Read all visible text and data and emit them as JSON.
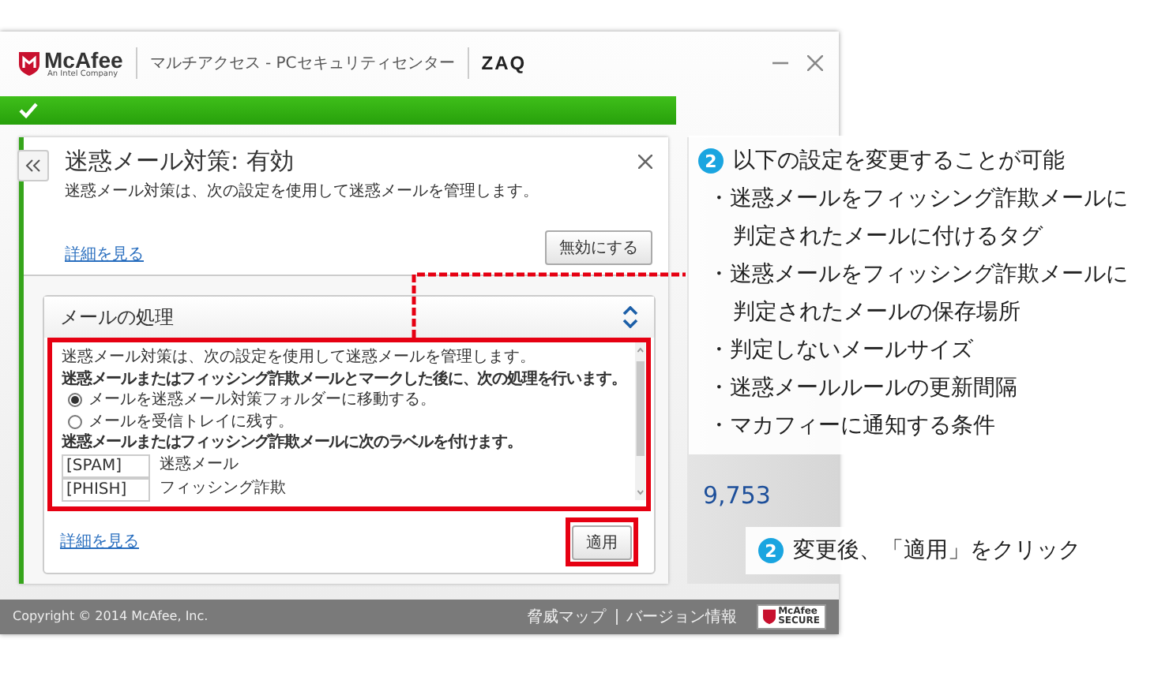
{
  "window": {
    "brand": "McAfee",
    "brand_sub": "An Intel Company",
    "title": "マルチアクセス - PCセキュリティセンター",
    "partner": "ZAQ"
  },
  "status": {
    "protected": true
  },
  "panel": {
    "title": "迷惑メール対策: 有効",
    "description": "迷惑メール対策は、次の設定を使用して迷惑メールを管理します。",
    "details_link": "詳細を見る",
    "disable_button": "無効にする"
  },
  "section": {
    "title": "メールの処理",
    "expanded": true,
    "intro": "迷惑メール対策は、次の設定を使用して迷惑メールを管理します。",
    "action_heading": "迷惑メールまたはフィッシング詐欺メールとマークした後に、次の処理を行います。",
    "options": [
      {
        "label": "メールを迷惑メール対策フォルダーに移動する。",
        "selected": true
      },
      {
        "label": "メールを受信トレイに残す。",
        "selected": false
      }
    ],
    "label_heading": "迷惑メールまたはフィッシング詐欺メールに次のラベルを付けます。",
    "labels": [
      {
        "value": "[SPAM]",
        "caption": "迷惑メール"
      },
      {
        "value": "[PHISH]",
        "caption": "フィッシング詐欺"
      }
    ],
    "details_link": "詳細を見る",
    "apply_button": "適用"
  },
  "sidebar": {
    "scan_count": "9,753"
  },
  "footer": {
    "copyright": "Copyright © 2014 McAfee, Inc.",
    "links": [
      "脅威マップ",
      "バージョン情報"
    ],
    "badge": [
      "McAfee",
      "SECURE"
    ]
  },
  "callouts": [
    {
      "number": "2",
      "text": "以下の設定を変更することが可能",
      "bullets": [
        "・迷惑メールをフィッシング詐欺メールに判定されたメールに付けるタグ",
        "・迷惑メールをフィッシング詐欺メールに判定されたメールの保存場所",
        "・判定しないメールサイズ",
        "・迷惑メールルールの更新間隔",
        "・マカフィーに通知する条件"
      ]
    },
    {
      "number": "2",
      "text": "変更後、「適用」をクリック"
    }
  ]
}
